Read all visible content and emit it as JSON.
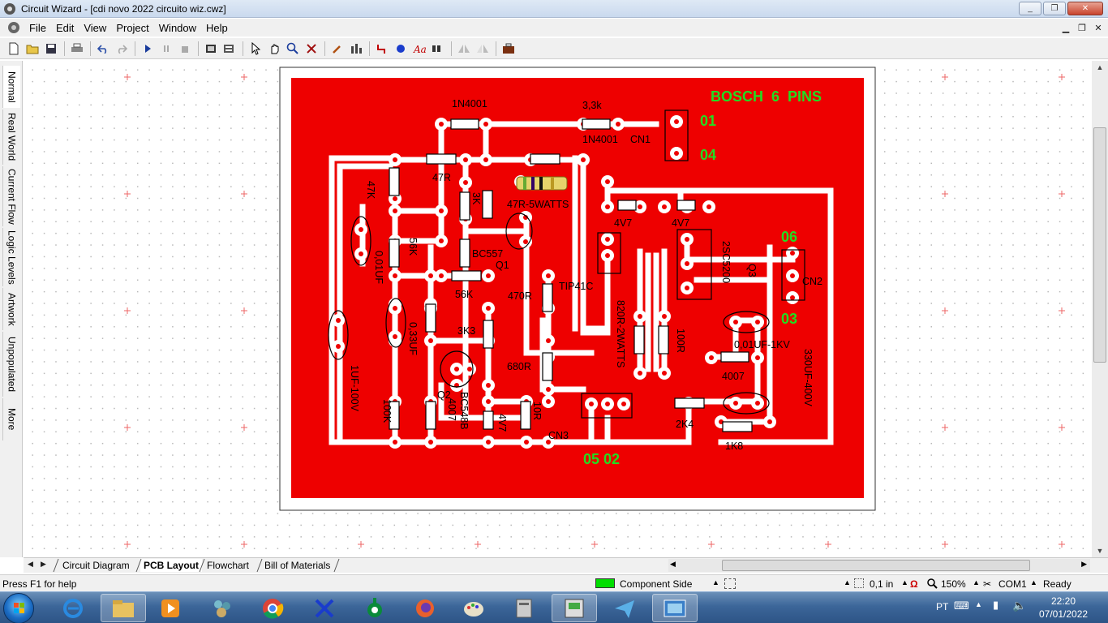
{
  "window": {
    "title": "Circuit Wizard - [cdi novo 2022 circuito wiz.cwz]",
    "controls": [
      "_",
      "❐",
      "✕"
    ]
  },
  "menu": {
    "items": [
      "File",
      "Edit",
      "View",
      "Project",
      "Window",
      "Help"
    ]
  },
  "toolbar": {
    "icons": [
      "new-icon",
      "open-icon",
      "save-icon",
      "print-icon",
      "undo-icon",
      "redo-icon",
      "play-icon",
      "pause-icon",
      "stop-icon",
      "component-view-icon",
      "layers-icon",
      "select-arrow-icon",
      "pan-hand-icon",
      "zoom-icon",
      "delete-icon",
      "probe-icon",
      "chart-icon",
      "track-icon",
      "pad-icon",
      "text-icon",
      "layout-icon",
      "flip-horizontal-icon",
      "flip-vertical-icon",
      "toolbox-icon"
    ]
  },
  "side_tabs": [
    "Normal",
    "Real World",
    "Current Flow",
    "Logic Levels",
    "Artwork",
    "Unpopulated",
    "More"
  ],
  "pcb": {
    "labels": {
      "title": "BOSCH  6  PINS",
      "pin01": "01",
      "pin04": "04",
      "pin06": "06",
      "pin03": "03",
      "pin0502": "05 02",
      "d1": "1N4001",
      "r33": "3,3k",
      "d2": "1N4001",
      "cn1": "CN1",
      "r47a": "47R",
      "r47b": "47K",
      "r47w": "47R-5WATTS",
      "r3k": "3K",
      "z1": "4V7",
      "z2": "4V7",
      "q1": "BC557",
      "q1n": "Q1",
      "r56a": "56K",
      "r56b": "56K",
      "c01": "0,01UF",
      "r470": "470R",
      "tip": "TIP41C",
      "q3": "2SC5200",
      "q3n": "Q3",
      "cn2": "CN2",
      "c033": "0,33UF",
      "r3k3": "3K3",
      "r820": "820R-2WATTS",
      "r100": "100R",
      "c001": "0,01UF-1KV",
      "c330": "330UF-400V",
      "r680": "680R",
      "d4007a": "4007",
      "d4007b": "4007",
      "q2": "Q2",
      "bc548": "BC548B",
      "c1uf": "1UF-100V",
      "r100k": "100K",
      "z47": "4V7",
      "r10": "10R",
      "cn3": "CN3",
      "r2k4": "2K4",
      "r1k8": "1K8"
    }
  },
  "bottom_tabs": [
    {
      "label": "Circuit Diagram",
      "active": false
    },
    {
      "label": "PCB Layout",
      "active": true
    },
    {
      "label": "Flowchart",
      "active": false
    },
    {
      "label": "Bill of Materials",
      "active": false
    }
  ],
  "status": {
    "help": "Press F1 for help",
    "layer": "Component Side",
    "layer_color": "#00dd00",
    "grid": "0,1 in",
    "zoom": "150%",
    "port": "COM1",
    "state": "Ready"
  },
  "taskbar": {
    "apps": [
      "internet-explorer-icon",
      "file-explorer-icon",
      "media-player-icon",
      "network-icon",
      "chrome-icon",
      "tools-icon",
      "circuit-icon",
      "firefox-icon",
      "paint-icon",
      "computer-icon",
      "circuit-wizard-icon",
      "messenger-icon",
      "screenshot-icon"
    ],
    "language": "PT",
    "time": "22:20",
    "date": "07/01/2022"
  },
  "colors": {
    "board": "#ee0000",
    "track": "#ffffff",
    "label_green": "#22dd22"
  }
}
